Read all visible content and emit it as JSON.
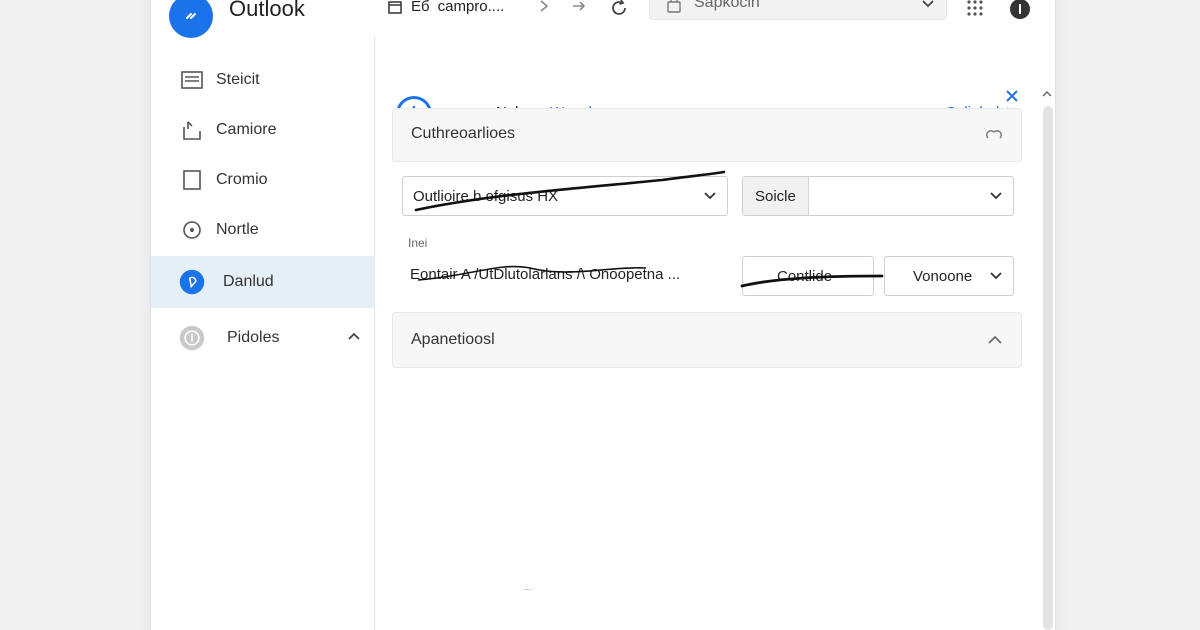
{
  "app": {
    "title": "Outlook"
  },
  "toolbar": {
    "tab_prefix": "Eб",
    "tab_label": "campro....",
    "address_text": "Sapkocln"
  },
  "sidebar": {
    "items": [
      {
        "label": "Steicit",
        "icon": "inbox-icon"
      },
      {
        "label": "Camiore",
        "icon": "share-icon"
      },
      {
        "label": "Cromio",
        "icon": "document-icon"
      },
      {
        "label": "Nortle",
        "icon": "refresh-icon"
      },
      {
        "label": "Danlud",
        "icon": "pin-icon",
        "active": true
      },
      {
        "label": "Pidoles",
        "icon": "info-circle-icon"
      }
    ]
  },
  "main": {
    "header": {
      "tab1": "Nol",
      "tab2": "Wapal",
      "link": "Salipled"
    },
    "panel1": {
      "title": "Cuthreoarlioes",
      "select1_value": "Outlioire b ofgisus HX",
      "select2_label": "Soicle",
      "small_label": "Inei",
      "row_text": "Eontair A /UtDlutolarlans /\\ Onoopetna ...",
      "field_label": "Contlide",
      "dropdown_value": "Vonoone"
    },
    "panel2": {
      "title": "Apanetioosl"
    },
    "footer_mark": "..."
  },
  "colors": {
    "accent": "#1a73e8",
    "active_bg": "#e5eff8"
  }
}
